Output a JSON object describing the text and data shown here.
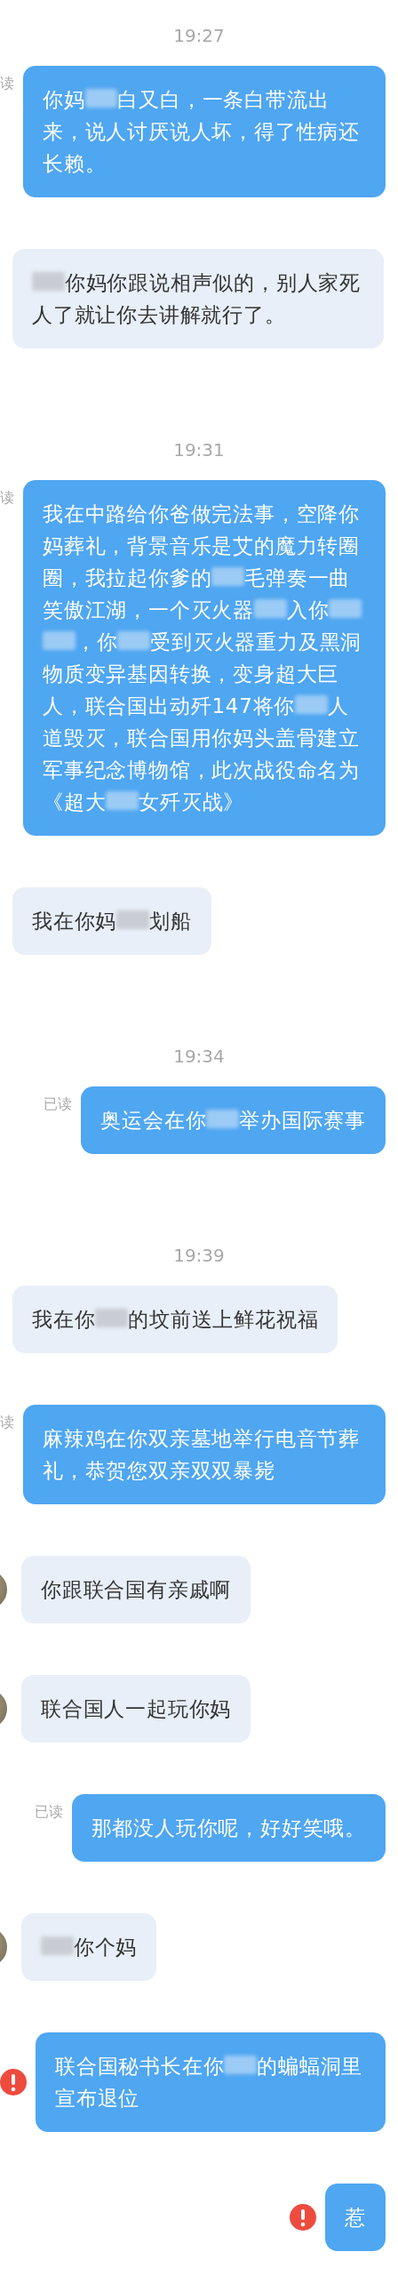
{
  "messages": [
    {
      "kind": "time",
      "text": "19:27"
    },
    {
      "kind": "sent",
      "read_label": "读",
      "failed": false,
      "segments": [
        {
          "kind": "text",
          "text": "你妈"
        },
        {
          "kind": "mosaic"
        },
        {
          "kind": "text",
          "text": "白又白，一条白带流出来，说人讨厌说人坏，得了性病还长赖。"
        }
      ]
    },
    {
      "kind": "received",
      "avatar": false,
      "segments": [
        {
          "kind": "mosaic"
        },
        {
          "kind": "text",
          "text": "你妈你跟说相声似的，别人家死人了就让你去讲解就行了。"
        }
      ]
    },
    {
      "kind": "time",
      "text": "19:31"
    },
    {
      "kind": "sent",
      "read_label": "读",
      "failed": false,
      "segments": [
        {
          "kind": "text",
          "text": "我在中路给你爸做完法事，空降你妈葬礼，背景音乐是艾的魔力转圈圈，我拉起你爹的"
        },
        {
          "kind": "mosaic"
        },
        {
          "kind": "text",
          "text": "毛弹奏一曲笑傲江湖，一个灭火器"
        },
        {
          "kind": "mosaic"
        },
        {
          "kind": "text",
          "text": "入你"
        },
        {
          "kind": "mosaic"
        },
        {
          "kind": "mosaic"
        },
        {
          "kind": "text",
          "text": "，你"
        },
        {
          "kind": "mosaic"
        },
        {
          "kind": "text",
          "text": "受到灭火器重力及黑洞物质变异基因转换，变身超大巨人，联合国出动歼147将你"
        },
        {
          "kind": "mosaic"
        },
        {
          "kind": "text",
          "text": "人道毁灭，联合国用你妈头盖骨建立军事纪念博物馆，此次战役命名为《超大"
        },
        {
          "kind": "mosaic"
        },
        {
          "kind": "text",
          "text": "女歼灭战》"
        }
      ]
    },
    {
      "kind": "received",
      "avatar": false,
      "segments": [
        {
          "kind": "text",
          "text": "我在你妈"
        },
        {
          "kind": "mosaic"
        },
        {
          "kind": "text",
          "text": "划船"
        }
      ]
    },
    {
      "kind": "time",
      "text": "19:34"
    },
    {
      "kind": "sent",
      "read_label": "已读",
      "failed": false,
      "segments": [
        {
          "kind": "text",
          "text": "奥运会在你"
        },
        {
          "kind": "mosaic"
        },
        {
          "kind": "text",
          "text": "举办国际赛事"
        }
      ]
    },
    {
      "kind": "time",
      "text": "19:39"
    },
    {
      "kind": "received",
      "avatar": false,
      "segments": [
        {
          "kind": "text",
          "text": "我在你"
        },
        {
          "kind": "mosaic"
        },
        {
          "kind": "text",
          "text": "的坟前送上鲜花祝福"
        }
      ]
    },
    {
      "kind": "sent",
      "read_label": "读",
      "failed": false,
      "segments": [
        {
          "kind": "text",
          "text": "麻辣鸡在你双亲墓地举行电音节葬礼，恭贺您双亲双双暴毙"
        }
      ]
    },
    {
      "kind": "received",
      "avatar": true,
      "segments": [
        {
          "kind": "text",
          "text": "你跟联合国有亲戚啊"
        }
      ]
    },
    {
      "kind": "received",
      "avatar": true,
      "segments": [
        {
          "kind": "text",
          "text": "联合国人一起玩你妈"
        }
      ]
    },
    {
      "kind": "sent",
      "read_label": "已读",
      "failed": false,
      "segments": [
        {
          "kind": "text",
          "text": "那都没人玩你呢，好好笑哦。"
        }
      ]
    },
    {
      "kind": "received",
      "avatar": true,
      "segments": [
        {
          "kind": "mosaic"
        },
        {
          "kind": "text",
          "text": "你个妈"
        }
      ]
    },
    {
      "kind": "sent",
      "failed": true,
      "segments": [
        {
          "kind": "text",
          "text": "联合国秘书长在你"
        },
        {
          "kind": "mosaic"
        },
        {
          "kind": "text",
          "text": "的蝙蝠洞里宣布退位"
        }
      ]
    },
    {
      "kind": "sent",
      "failed": true,
      "segments": [
        {
          "kind": "text",
          "text": "惹"
        }
      ]
    }
  ]
}
